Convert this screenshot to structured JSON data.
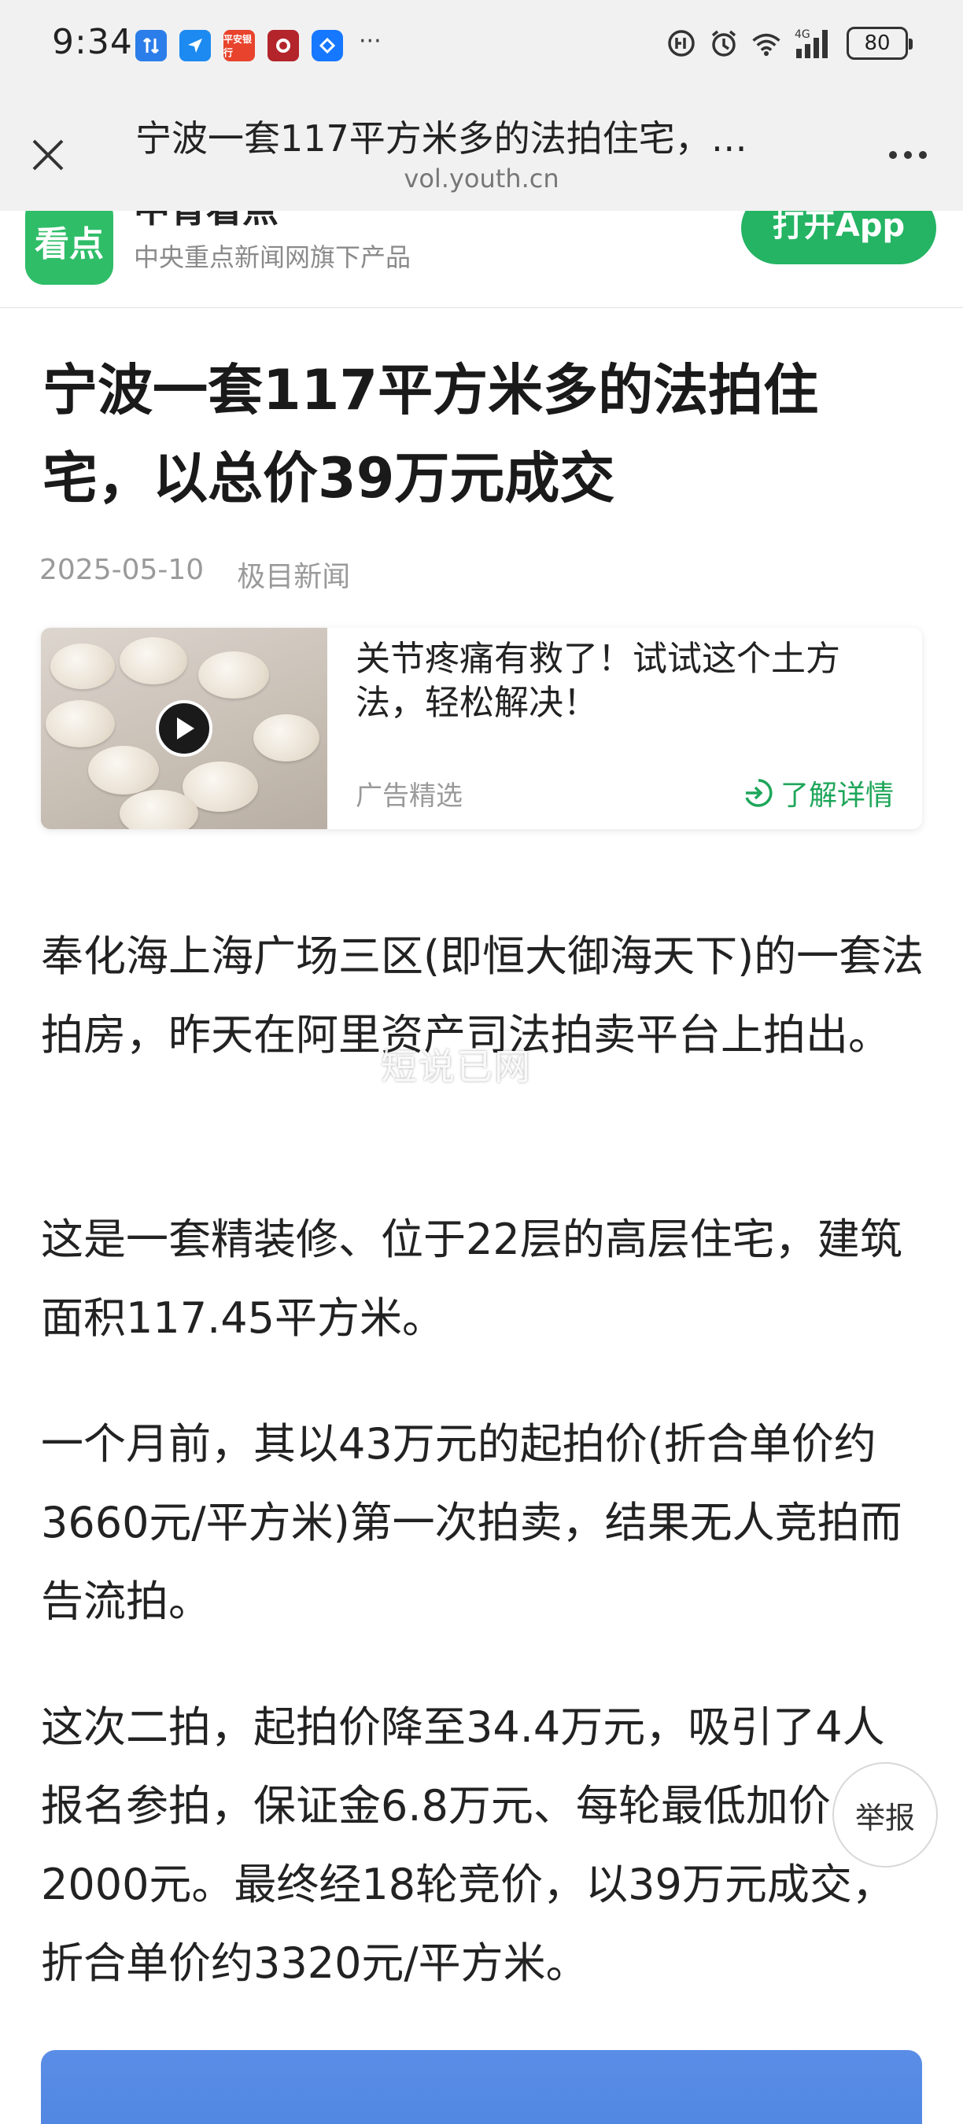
{
  "status_bar": {
    "time": "9:34",
    "notification_icons": [
      "arrows-app-icon",
      "navigation-app-icon",
      "pingan-bank-icon",
      "game-app-icon",
      "pay-app-icon"
    ],
    "pingan_bank_text": "平安银行",
    "more": "···",
    "network_label": "4G",
    "battery": "80"
  },
  "browser": {
    "title": "宁波一套117平方米多的法拍住宅，…",
    "url": "vol.youth.cn"
  },
  "app_banner": {
    "logo_text": "看点",
    "app_name": "中青看点",
    "subtitle": "中央重点新闻网旗下产品",
    "open_button": "打开App"
  },
  "article": {
    "headline": "宁波一套117平方米多的法拍住宅，以总价39万元成交",
    "date": "2025-05-10",
    "source": "极目新闻",
    "paragraphs": [
      "奉化海上海广场三区(即恒大御海天下)的一套法拍房，昨天在阿里资产司法拍卖平台上拍出。",
      "这是一套精装修、位于22层的高层住宅，建筑面积117.45平方米。",
      "一个月前，其以43万元的起拍价(折合单价约3660元/平方米)第一次拍卖，结果无人竞拍而告流拍。",
      "这次二拍，起拍价降至34.4万元，吸引了4人报名参拍，保证金6.8万元、每轮最低加价2000元。最终经18轮竞价，以39万元成交，折合单价约3320元/平方米。"
    ],
    "watermark": "短说已网"
  },
  "ad": {
    "title": "关节疼痛有救了！试试这个土方法，轻松解决！",
    "label": "广告精选",
    "more": "了解详情"
  },
  "report_button": "举报",
  "colors": {
    "brand_green": "#24b463",
    "link_green": "#1ea65a",
    "bar_gray": "#f1f1f1"
  }
}
